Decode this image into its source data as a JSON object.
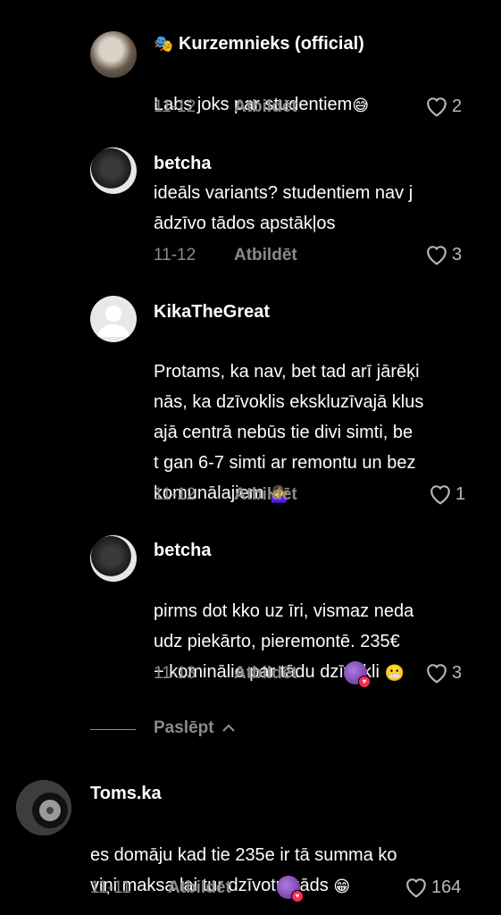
{
  "comments": [
    {
      "username": "Kurzemnieks (official)",
      "badge_emoji": "🎭",
      "text": "Labs joks par studentiem",
      "text_emoji": "😅",
      "date": "11-12",
      "reply_label": "Atbildēt",
      "likes": "2"
    },
    {
      "username": "betcha",
      "text": "ideāls variants? studentiem nav j\nādzīvo tādos apstākļos",
      "date": "11-12",
      "reply_label": "Atbildēt",
      "likes": "3"
    },
    {
      "username": "KikaTheGreat",
      "text": "Protams, ka nav, bet tad arī jārēķi\nnās, ka dzīvoklis ekskluzīvajā klus\najā centrā nebūs tie divi simti, be\nt gan 6-7 simti ar remontu un bez\nkomunālajiem",
      "text_emoji": "🤷‍♀️",
      "date": "11-12",
      "reply_label": "Atbildēt",
      "likes": "1"
    },
    {
      "username": "betcha",
      "text": "pirms dot kko uz īri, vismaz neda\nudz piekārto, pieremontē. 235€\n+ kominālie par tādu dzīvokli",
      "text_emoji": "😬",
      "date": "11-13",
      "reply_label": "Atbildēt",
      "likes": "3"
    }
  ],
  "hide_replies_label": "Paslēpt",
  "top_comment": {
    "username": "Toms.ka",
    "text": "es domāju kad tie 235e ir tā summa ko\nviņi maksa lai tur dzīvotu kāds",
    "text_emoji": "😁",
    "date": "11-11",
    "reply_label": "Atbildēt",
    "likes": "164"
  },
  "colors": {
    "background": "#000000",
    "text": "#ffffff",
    "meta": "#8a8a8a",
    "creator_like_badge": "#7b3fb3",
    "heart_badge": "#fe2c55"
  }
}
